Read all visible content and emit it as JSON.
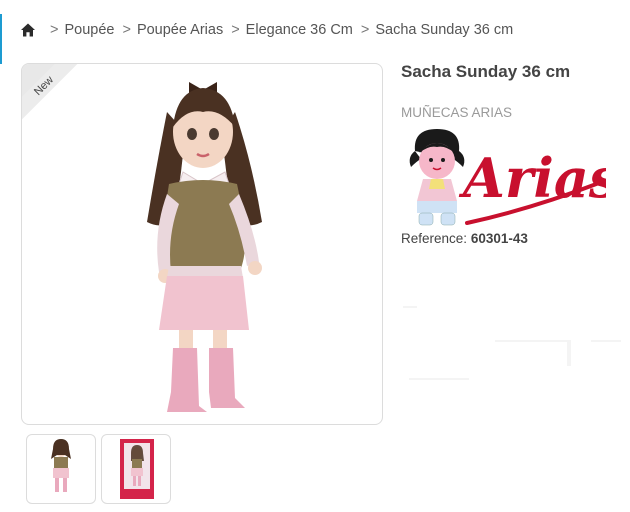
{
  "breadcrumb": {
    "home_icon": "home-icon",
    "separator": ">",
    "items": [
      "Poupée",
      "Poupée Arias",
      "Elegance 36 Cm",
      "Sacha Sunday 36 cm"
    ]
  },
  "product": {
    "badge": "New",
    "title": "Sacha Sunday 36 cm",
    "brand": "MUÑECAS ARIAS",
    "brand_logo_text": "Arias",
    "reference_label": "Reference:",
    "reference_value": "60301-43"
  },
  "colors": {
    "accent": "#1d9bd1",
    "logo_red": "#c8102e",
    "border": "#dcdcdc"
  }
}
